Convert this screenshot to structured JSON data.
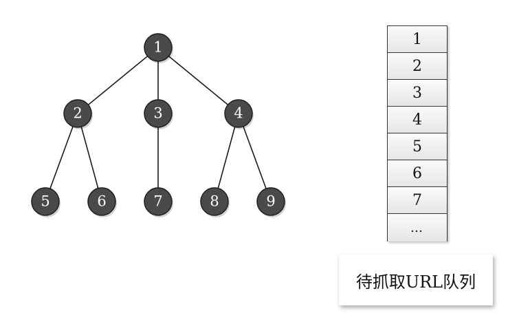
{
  "tree": {
    "nodes": [
      {
        "id": "1",
        "label": "1"
      },
      {
        "id": "2",
        "label": "2"
      },
      {
        "id": "3",
        "label": "3"
      },
      {
        "id": "4",
        "label": "4"
      },
      {
        "id": "5",
        "label": "5"
      },
      {
        "id": "6",
        "label": "6"
      },
      {
        "id": "7",
        "label": "7"
      },
      {
        "id": "8",
        "label": "8"
      },
      {
        "id": "9",
        "label": "9"
      }
    ],
    "edges": [
      [
        "1",
        "2"
      ],
      [
        "1",
        "3"
      ],
      [
        "1",
        "4"
      ],
      [
        "2",
        "5"
      ],
      [
        "2",
        "6"
      ],
      [
        "3",
        "7"
      ],
      [
        "4",
        "8"
      ],
      [
        "4",
        "9"
      ]
    ]
  },
  "queue": {
    "items": [
      "1",
      "2",
      "3",
      "4",
      "5",
      "6",
      "7",
      "…"
    ]
  },
  "caption": "待抓取URL队列",
  "colors": {
    "node_fill": "#4a4a4a",
    "node_text": "#ffffff"
  }
}
